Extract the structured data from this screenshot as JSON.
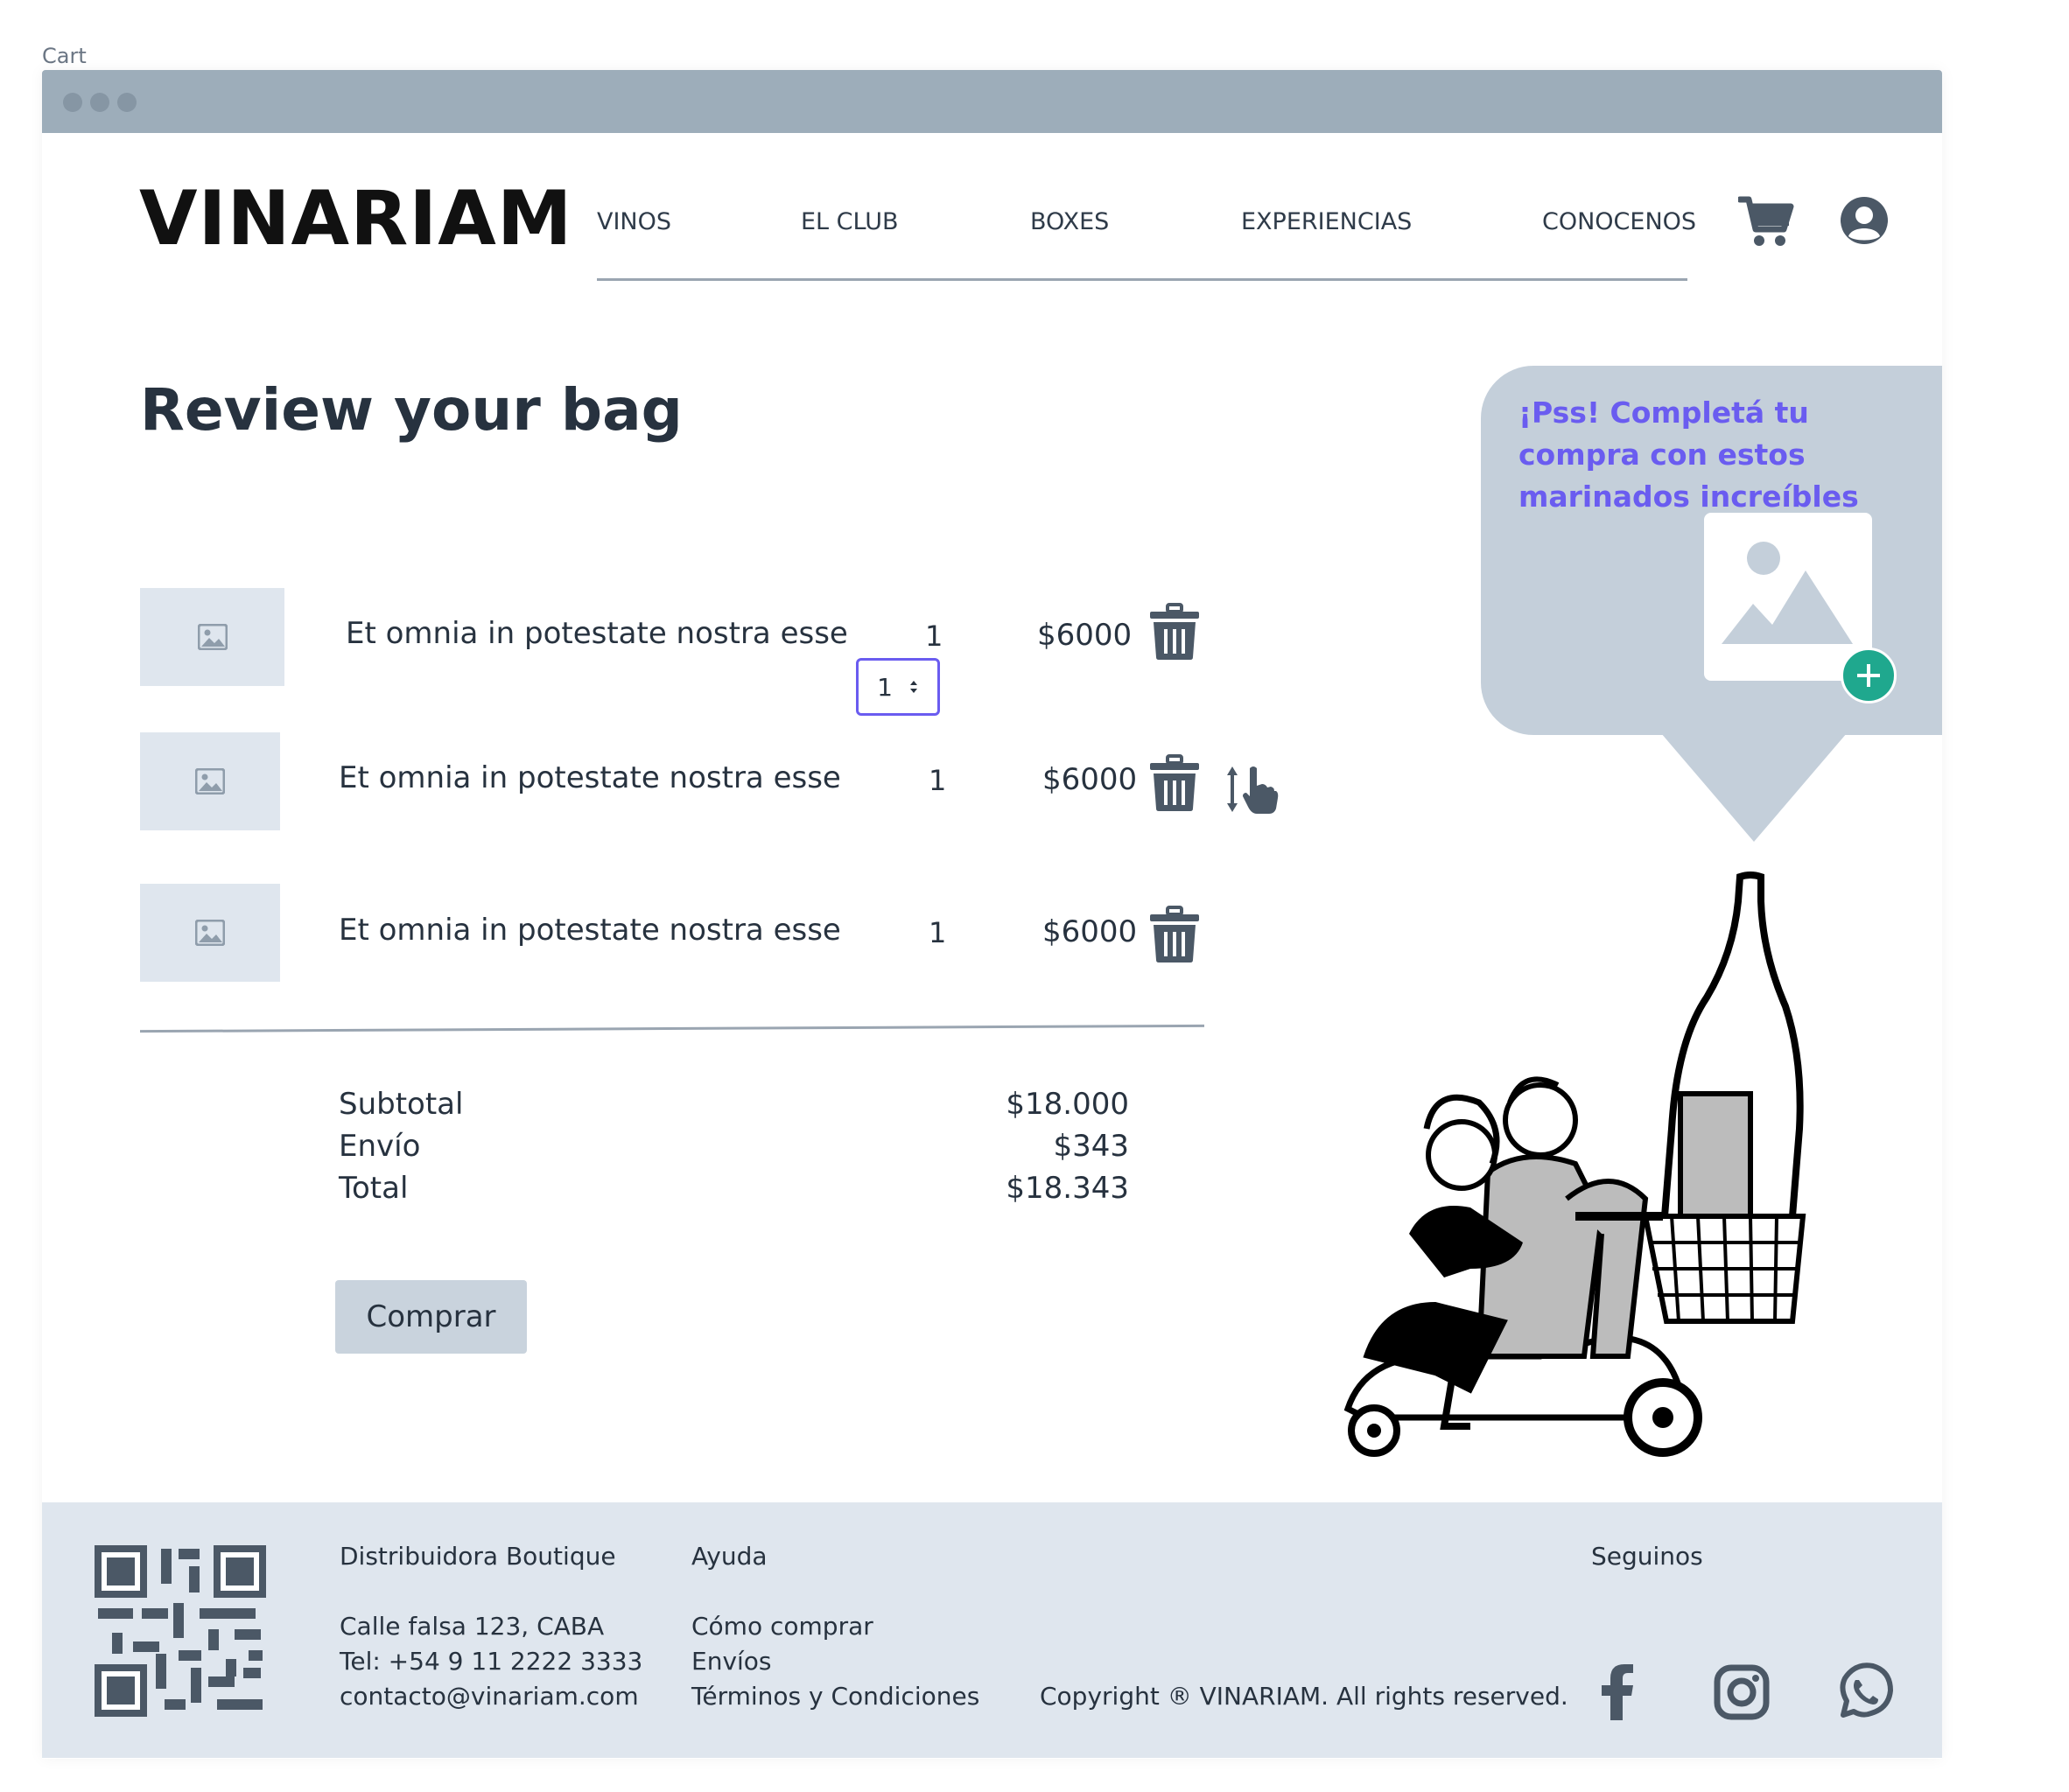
{
  "window": {
    "label": "Cart"
  },
  "header": {
    "logo": "VINARIAM",
    "nav": [
      "VINOS",
      "EL CLUB",
      "BOXES",
      "EXPERIENCIAS",
      "CONOCENOS"
    ],
    "icons": [
      "cart-icon",
      "user-icon"
    ]
  },
  "main": {
    "title": "Review your bag",
    "items": [
      {
        "name": "Et omnia in potestate nostra esse",
        "qty": "1",
        "price": "$6000"
      },
      {
        "name": "Et omnia in potestate nostra esse",
        "qty": "1",
        "price": "$6000"
      },
      {
        "name": "Et omnia in potestate nostra esse",
        "qty": "1",
        "price": "$6000"
      }
    ],
    "qty_select_value": "1",
    "summary": {
      "subtotal_label": "Subtotal",
      "subtotal": "$18.000",
      "shipping_label": "Envío",
      "shipping": "$343",
      "total_label": "Total",
      "total": "$18.343"
    },
    "buy_label": "Comprar"
  },
  "promo": {
    "text": "¡Pss! Completá tu compra con estos marinados increíbles"
  },
  "footer": {
    "company_title": "Distribuidora Boutique",
    "address": "Calle falsa 123, CABA",
    "phone": "Tel: +54 9 11 2222 3333",
    "email": "contacto@vinariam.com",
    "help_title": "Ayuda",
    "help_links": [
      "Cómo comprar",
      "Envíos",
      "Términos y Condiciones"
    ],
    "copyright": "Copyright ® VINARIAM. All rights reserved.",
    "social_title": "Seguinos",
    "social_icons": [
      "facebook-icon",
      "instagram-icon",
      "whatsapp-icon"
    ]
  },
  "colors": {
    "accent": "#6a5cf0",
    "green": "#1fa88e",
    "slate": "#4b5866",
    "panel": "#c4cfda",
    "footer": "#dfe6ee"
  }
}
